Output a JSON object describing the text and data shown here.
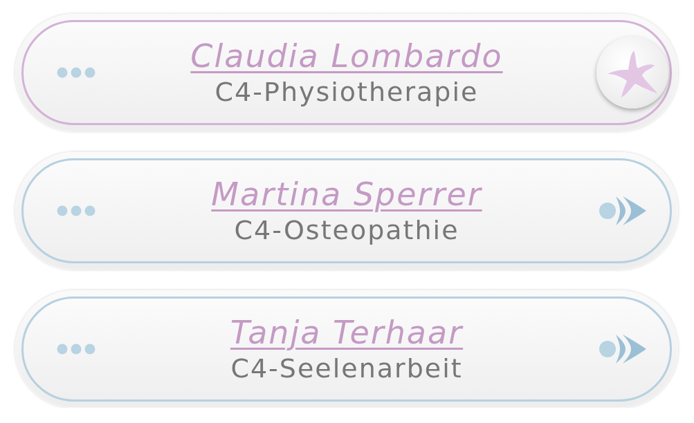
{
  "contacts": [
    {
      "name": "Claudia Lombardo",
      "department": "C4-Physiotherapie",
      "selected": true
    },
    {
      "name": "Martina Sperrer",
      "department": "C4-Osteopathie",
      "selected": false
    },
    {
      "name": "Tanja Terhaar",
      "department": "C4-Seelenarbeit",
      "selected": false
    }
  ]
}
